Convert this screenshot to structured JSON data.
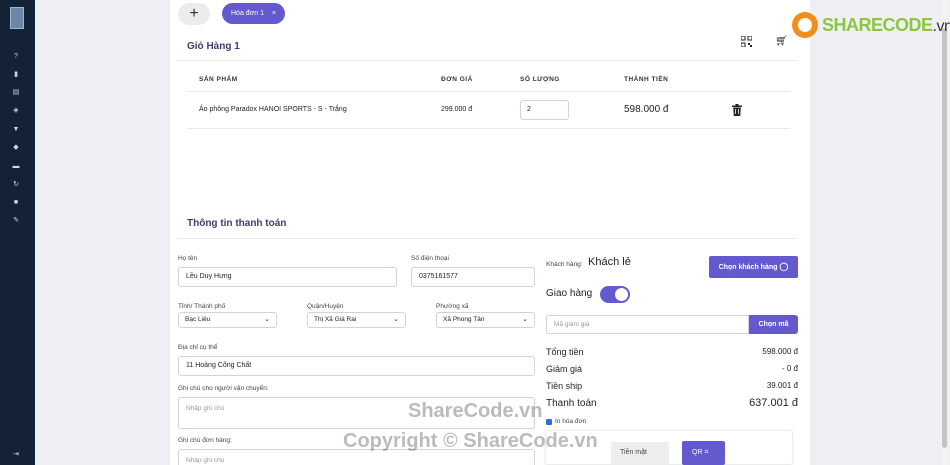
{
  "tabs": {
    "add_label": "+",
    "invoice_tab": "Hóa đơn 1",
    "close_label": "×"
  },
  "cart": {
    "title": "Giỏ Hàng 1",
    "columns": [
      "SẢN PHẨM",
      "ĐƠN GIÁ",
      "SỐ LƯỢNG",
      "THÀNH TIỀN"
    ],
    "rows": [
      {
        "product": "Áo phông Paradox HANOI SPORTS - S - Trắng",
        "unit_price": "299.000 đ",
        "quantity": "2",
        "total": "598.000 đ"
      }
    ]
  },
  "payment": {
    "title": "Thông tin thanh toán",
    "name_label": "Họ tên",
    "name_value": "Lều Duy Hưng",
    "phone_label": "Số điện thoại",
    "phone_value": "0375161577",
    "province_label": "Tỉnh/ Thành phố",
    "province_value": "Bạc Liêu",
    "district_label": "Quận/Huyện",
    "district_value": "Thị Xã Giá Rai",
    "ward_label": "Phường xã",
    "ward_value": "Xã Phong Tân",
    "address_label": "Địa chỉ cụ thể",
    "address_value": "11 Hoàng Công Chất",
    "shipper_note_label": "Ghi chú cho người vận chuyển:",
    "shipper_note_placeholder": "Nhập ghi chú",
    "order_note_label": "Ghi chú đơn hàng:",
    "order_note_placeholder": "Nhập ghi chú"
  },
  "summary": {
    "customer_label": "Khách hàng:",
    "customer_value": "Khách lẻ",
    "choose_customer_button": "Chọn khách hàng",
    "delivery_label": "Giao hàng",
    "delivery_enabled": true,
    "coupon_placeholder": "Mã giảm giá",
    "choose_code_button": "Chọn mã",
    "total_label": "Tổng tiền",
    "total_value": "598.000 đ",
    "discount_label": "Giảm giá",
    "discount_value": "- 0 đ",
    "ship_label": "Tiền ship",
    "ship_value": "39.001 đ",
    "pay_label": "Thanh toán",
    "pay_value": "637.001 đ",
    "print_invoice_label": "In hóa đơn",
    "print_invoice_checked": true,
    "cash_label": "Tiền mặt",
    "qr_button": "QR"
  },
  "brand": {
    "name": "SHARECODE",
    "suffix": ".vn"
  },
  "watermark": {
    "line1": "ShareCode.vn",
    "line2": "Copyright © ShareCode.vn"
  },
  "colors": {
    "accent": "#6459cf",
    "sidebar": "#142237",
    "brand_green": "#8cc63f",
    "brand_orange": "#f28c1c"
  }
}
